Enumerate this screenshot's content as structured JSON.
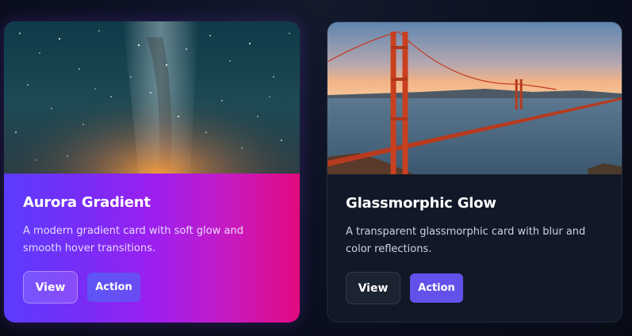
{
  "cards": [
    {
      "title": "Aurora Gradient",
      "description": "A modern gradient card with soft glow and smooth hover transitions.",
      "image": "milky-way-night-sky",
      "view_label": "View",
      "action_label": "Action"
    },
    {
      "title": "Glassmorphic Glow",
      "description": "A transparent glassmorphic card with blur and color reflections.",
      "image": "golden-gate-bridge-sunset",
      "view_label": "View",
      "action_label": "Action"
    }
  ],
  "colors": {
    "background": "#0b1020",
    "aurora_gradient_start": "#5b3cff",
    "aurora_gradient_mid": "#9b1ff0",
    "aurora_gradient_end": "#e2097f",
    "glass_card": "#121827",
    "action_button": "#6351ec"
  }
}
